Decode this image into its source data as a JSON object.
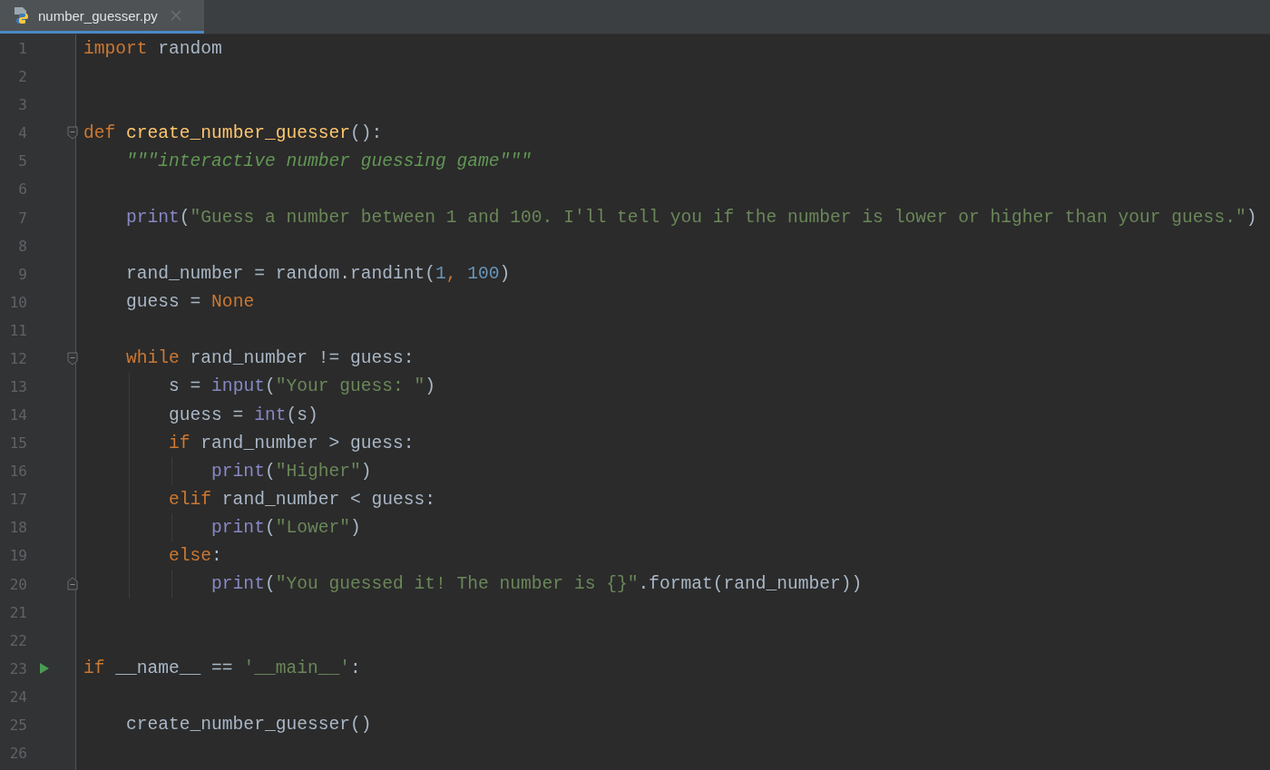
{
  "tabs": [
    {
      "title": "number_guesser.py",
      "selected": true
    }
  ],
  "editor": {
    "lines": [
      {
        "number": "1",
        "kind": "code",
        "tokens": [
          {
            "kind": "keyword",
            "text": "import "
          },
          {
            "kind": "plain",
            "text": "random"
          }
        ]
      },
      {
        "number": "2",
        "kind": "code"
      },
      {
        "number": "3",
        "kind": "code"
      },
      {
        "number": "4",
        "kind": "fold_start",
        "tokens": [
          {
            "kind": "keyword",
            "text": "def "
          },
          {
            "kind": "function",
            "text": "create_number_guesser"
          },
          {
            "kind": "plain",
            "text": "():"
          }
        ]
      },
      {
        "number": "5",
        "kind": "code",
        "tokens": [
          {
            "kind": "docstring",
            "text": "    \"\"\"interactive number guessing game\"\"\""
          }
        ]
      },
      {
        "number": "6",
        "kind": "code"
      },
      {
        "number": "7",
        "kind": "code",
        "tokens": [
          {
            "kind": "builtin",
            "text": "    print"
          },
          {
            "kind": "plain",
            "text": "("
          },
          {
            "kind": "string",
            "text": "\"Guess a number between 1 and 100. I'll tell you if the number is lower or higher than your guess.\""
          },
          {
            "kind": "plain",
            "text": ")"
          }
        ]
      },
      {
        "number": "8",
        "kind": "code"
      },
      {
        "number": "9",
        "kind": "code",
        "tokens": [
          {
            "kind": "plain",
            "text": "    rand_number = random.randint("
          },
          {
            "kind": "number",
            "text": "1"
          },
          {
            "kind": "keyword",
            "text": ", "
          },
          {
            "kind": "number",
            "text": "100"
          },
          {
            "kind": "plain",
            "text": ")"
          }
        ]
      },
      {
        "number": "10",
        "kind": "code",
        "tokens": [
          {
            "kind": "plain",
            "text": "    guess = "
          },
          {
            "kind": "keyword",
            "text": "None"
          }
        ]
      },
      {
        "number": "11",
        "kind": "code"
      },
      {
        "number": "12",
        "kind": "fold_start",
        "tokens": [
          {
            "kind": "keyword",
            "text": "    while "
          },
          {
            "kind": "plain",
            "text": "rand_number != guess:"
          }
        ]
      },
      {
        "number": "13",
        "kind": "code",
        "tokens": [
          {
            "kind": "plain",
            "text": "        s = "
          },
          {
            "kind": "builtin",
            "text": "input"
          },
          {
            "kind": "plain",
            "text": "("
          },
          {
            "kind": "string",
            "text": "\"Your guess: \""
          },
          {
            "kind": "plain",
            "text": ")"
          }
        ]
      },
      {
        "number": "14",
        "kind": "code",
        "tokens": [
          {
            "kind": "plain",
            "text": "        guess = "
          },
          {
            "kind": "builtin",
            "text": "int"
          },
          {
            "kind": "plain",
            "text": "(s)"
          }
        ]
      },
      {
        "number": "15",
        "kind": "code",
        "tokens": [
          {
            "kind": "keyword",
            "text": "        if "
          },
          {
            "kind": "plain",
            "text": "rand_number > guess:"
          }
        ]
      },
      {
        "number": "16",
        "kind": "code",
        "tokens": [
          {
            "kind": "builtin",
            "text": "            print"
          },
          {
            "kind": "plain",
            "text": "("
          },
          {
            "kind": "string",
            "text": "\"Higher\""
          },
          {
            "kind": "plain",
            "text": ")"
          }
        ]
      },
      {
        "number": "17",
        "kind": "code",
        "tokens": [
          {
            "kind": "keyword",
            "text": "        elif "
          },
          {
            "kind": "plain",
            "text": "rand_number < guess:"
          }
        ]
      },
      {
        "number": "18",
        "kind": "code",
        "tokens": [
          {
            "kind": "builtin",
            "text": "            print"
          },
          {
            "kind": "plain",
            "text": "("
          },
          {
            "kind": "string",
            "text": "\"Lower\""
          },
          {
            "kind": "plain",
            "text": ")"
          }
        ]
      },
      {
        "number": "19",
        "kind": "code",
        "tokens": [
          {
            "kind": "keyword",
            "text": "        else"
          },
          {
            "kind": "plain",
            "text": ":"
          }
        ]
      },
      {
        "number": "20",
        "kind": "fold_end",
        "tokens": [
          {
            "kind": "builtin",
            "text": "            print"
          },
          {
            "kind": "plain",
            "text": "("
          },
          {
            "kind": "string",
            "text": "\"You guessed it! The number is {}\""
          },
          {
            "kind": "plain",
            "text": ".format(rand_number))"
          }
        ]
      },
      {
        "number": "21",
        "kind": "code"
      },
      {
        "number": "22",
        "kind": "code"
      },
      {
        "number": "23",
        "kind": "run",
        "tokens": [
          {
            "kind": "keyword",
            "text": "if "
          },
          {
            "kind": "plain",
            "text": "__name__ == "
          },
          {
            "kind": "string",
            "text": "'__main__'"
          },
          {
            "kind": "plain",
            "text": ":"
          }
        ]
      },
      {
        "number": "24",
        "kind": "code"
      },
      {
        "number": "25",
        "kind": "code",
        "tokens": [
          {
            "kind": "plain",
            "text": "    create_number_guesser()"
          }
        ]
      },
      {
        "number": "26",
        "kind": "code"
      }
    ]
  }
}
